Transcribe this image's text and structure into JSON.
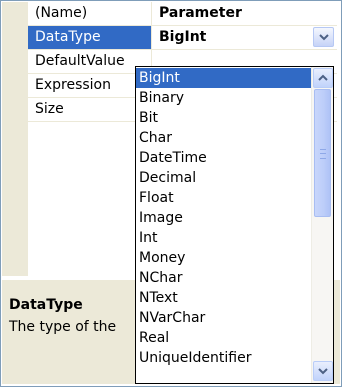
{
  "property_grid": {
    "rows": [
      {
        "name": "(Name)",
        "value": "Parameter"
      },
      {
        "name": "DataType",
        "value": "BigInt",
        "selected": true
      },
      {
        "name": "DefaultValue",
        "value": ""
      },
      {
        "name": "Expression",
        "value": ""
      },
      {
        "name": "Size",
        "value": ""
      }
    ]
  },
  "description": {
    "title": "DataType",
    "text": "The type of the"
  },
  "dropdown": {
    "selected": "BigInt",
    "options": [
      "BigInt",
      "Binary",
      "Bit",
      "Char",
      "DateTime",
      "Decimal",
      "Float",
      "Image",
      "Int",
      "Money",
      "NChar",
      "NText",
      "NVarChar",
      "Real",
      "UniqueIdentifier"
    ]
  },
  "icons": {
    "combo": "chevron-down-icon",
    "scroll_up": "chevron-up-icon",
    "scroll_down": "chevron-down-icon"
  },
  "colors": {
    "selection": "#316ac5",
    "gutter": "#ece9d8"
  }
}
